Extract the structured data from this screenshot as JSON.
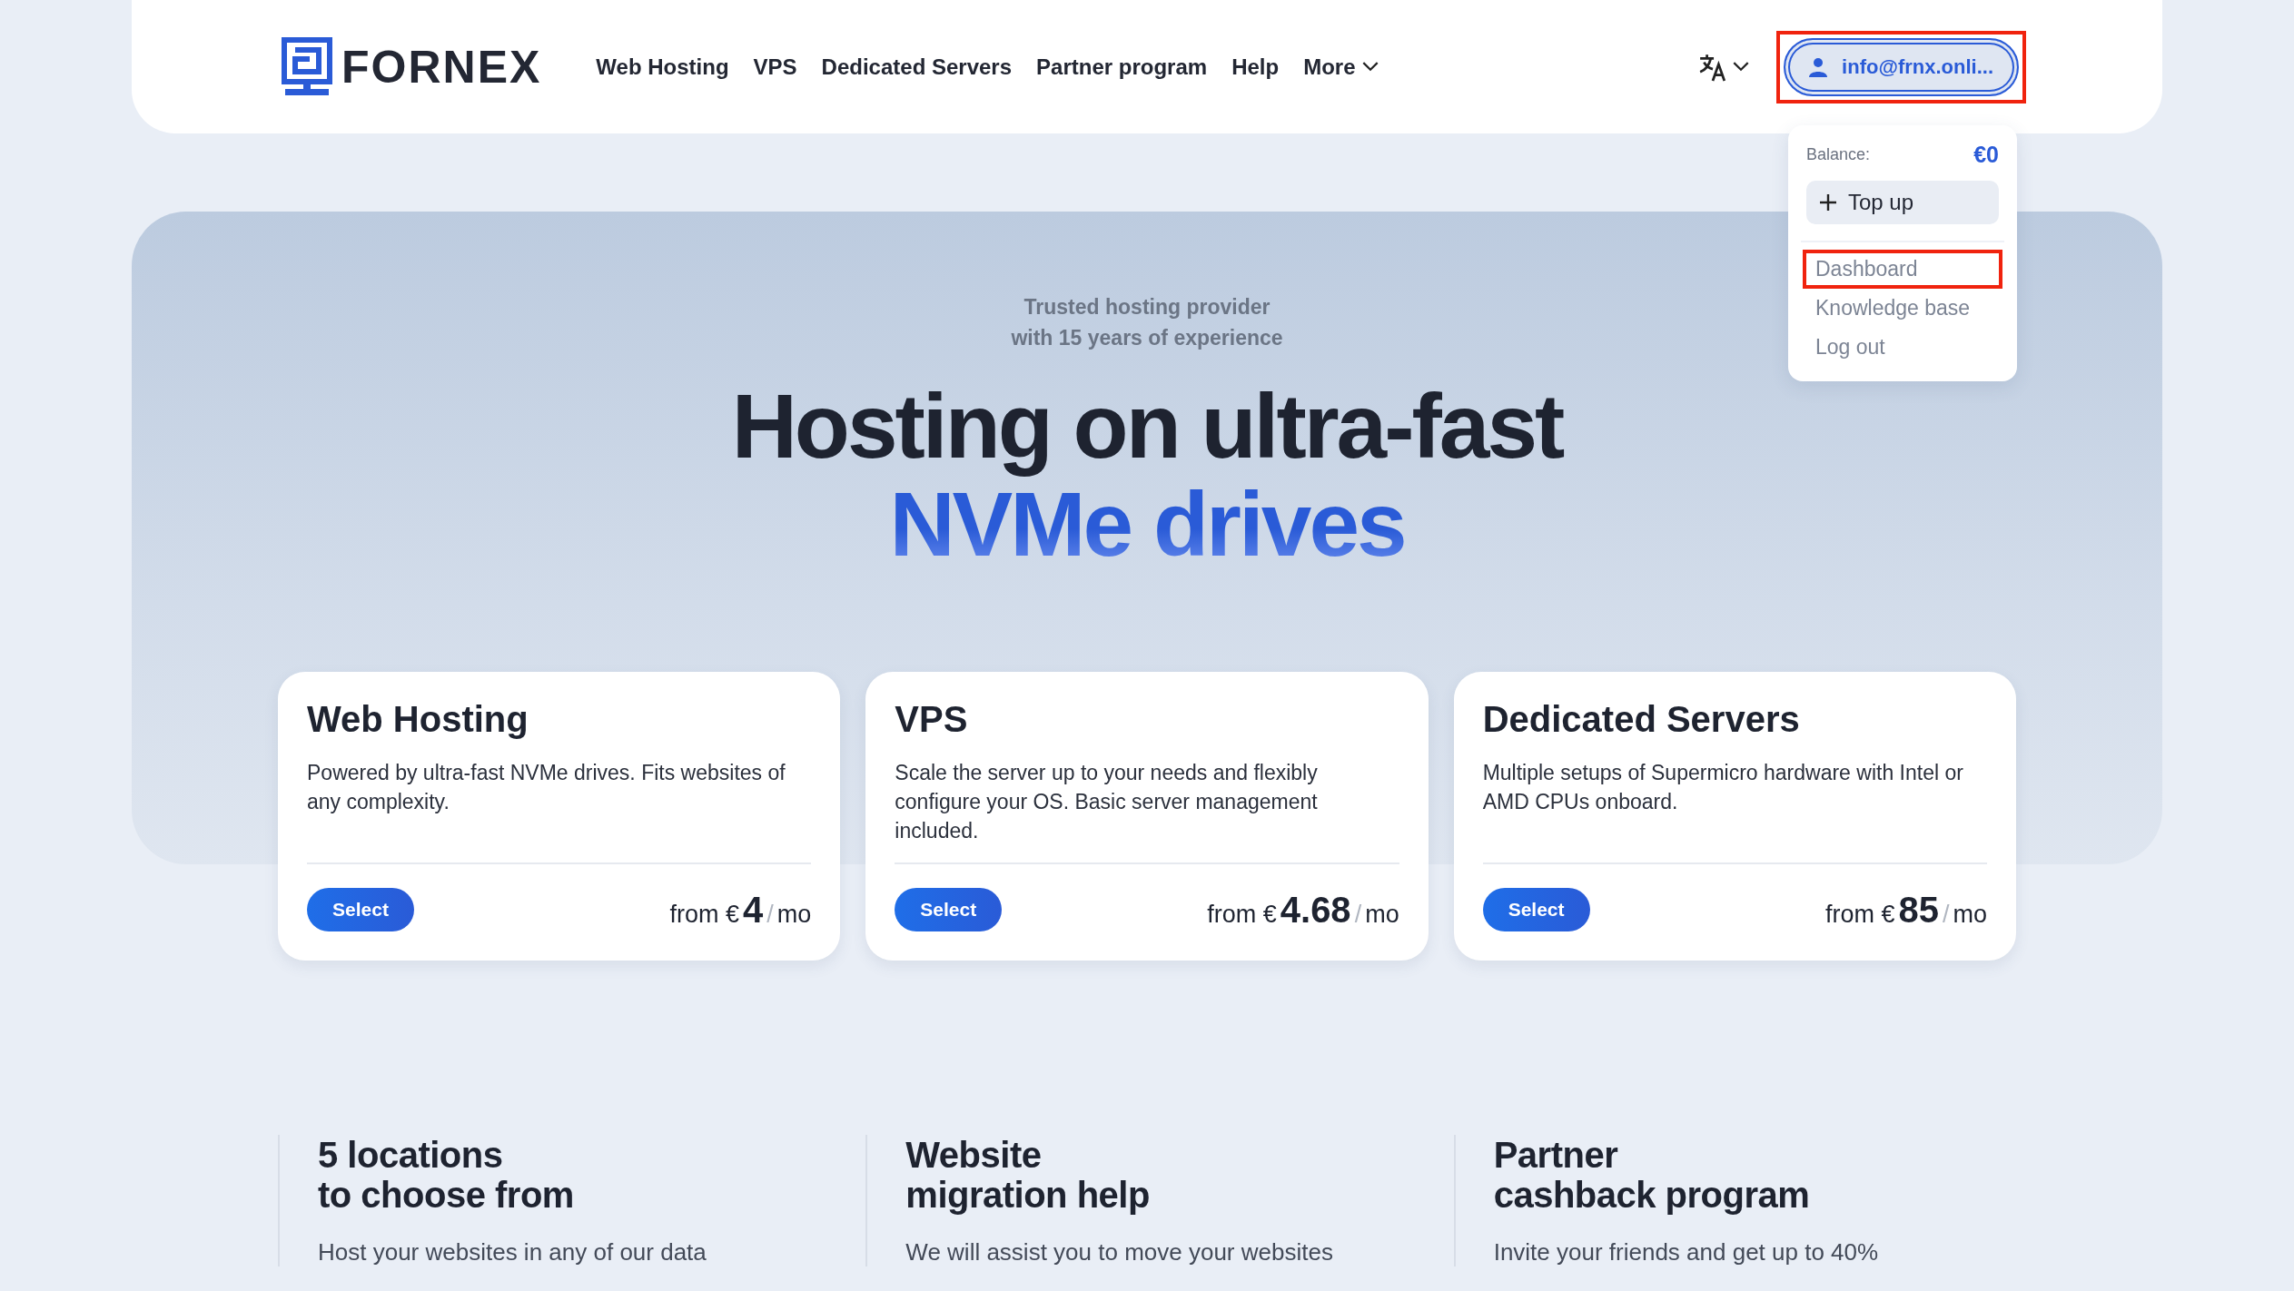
{
  "header": {
    "logo": "FORNEX",
    "nav": [
      {
        "label": "Web Hosting",
        "dropdown": false
      },
      {
        "label": "VPS",
        "dropdown": false
      },
      {
        "label": "Dedicated Servers",
        "dropdown": false
      },
      {
        "label": "Partner program",
        "dropdown": false
      },
      {
        "label": "Help",
        "dropdown": false
      },
      {
        "label": "More",
        "dropdown": true
      }
    ],
    "account": {
      "label": "info@frnx.onli...",
      "highlighted": true
    }
  },
  "account_menu": {
    "balance_label": "Balance:",
    "balance_value": "€0",
    "top_up": "Top up",
    "items": [
      {
        "label": "Dashboard",
        "highlighted": true
      },
      {
        "label": "Knowledge base",
        "highlighted": false
      },
      {
        "label": "Log out",
        "highlighted": false
      }
    ]
  },
  "hero": {
    "subtitle_lines": [
      "Trusted hosting provider",
      "with 15 years of experience"
    ],
    "headline": "Hosting on ultra-fast",
    "headline_accent": "NVMe drives"
  },
  "plans": [
    {
      "title": "Web Hosting",
      "description": "Powered by ultra-fast NVMe drives. Fits websites of any complexity.",
      "button": "Select",
      "from": "from €",
      "price": "4",
      "unit": "/",
      "period": "mo"
    },
    {
      "title": "VPS",
      "description": "Scale the server up to your needs and flexibly configure your OS. Basic server management included.",
      "button": "Select",
      "from": "from €",
      "price": "4.68",
      "unit": "/",
      "period": "mo"
    },
    {
      "title": "Dedicated Servers",
      "description": "Multiple setups of Supermicro hardware with Intel or AMD CPUs onboard.",
      "button": "Select",
      "from": "from €",
      "price": "85",
      "unit": "/",
      "period": "mo"
    }
  ],
  "features": [
    {
      "title_lines": [
        "5 locations",
        "to choose from"
      ],
      "description": "Host your websites in any of our data"
    },
    {
      "title_lines": [
        "Website",
        "migration help"
      ],
      "description": "We will assist you to move your websites"
    },
    {
      "title_lines": [
        "Partner",
        "cashback program"
      ],
      "description": "Invite your friends and get up to 40%"
    }
  ]
}
